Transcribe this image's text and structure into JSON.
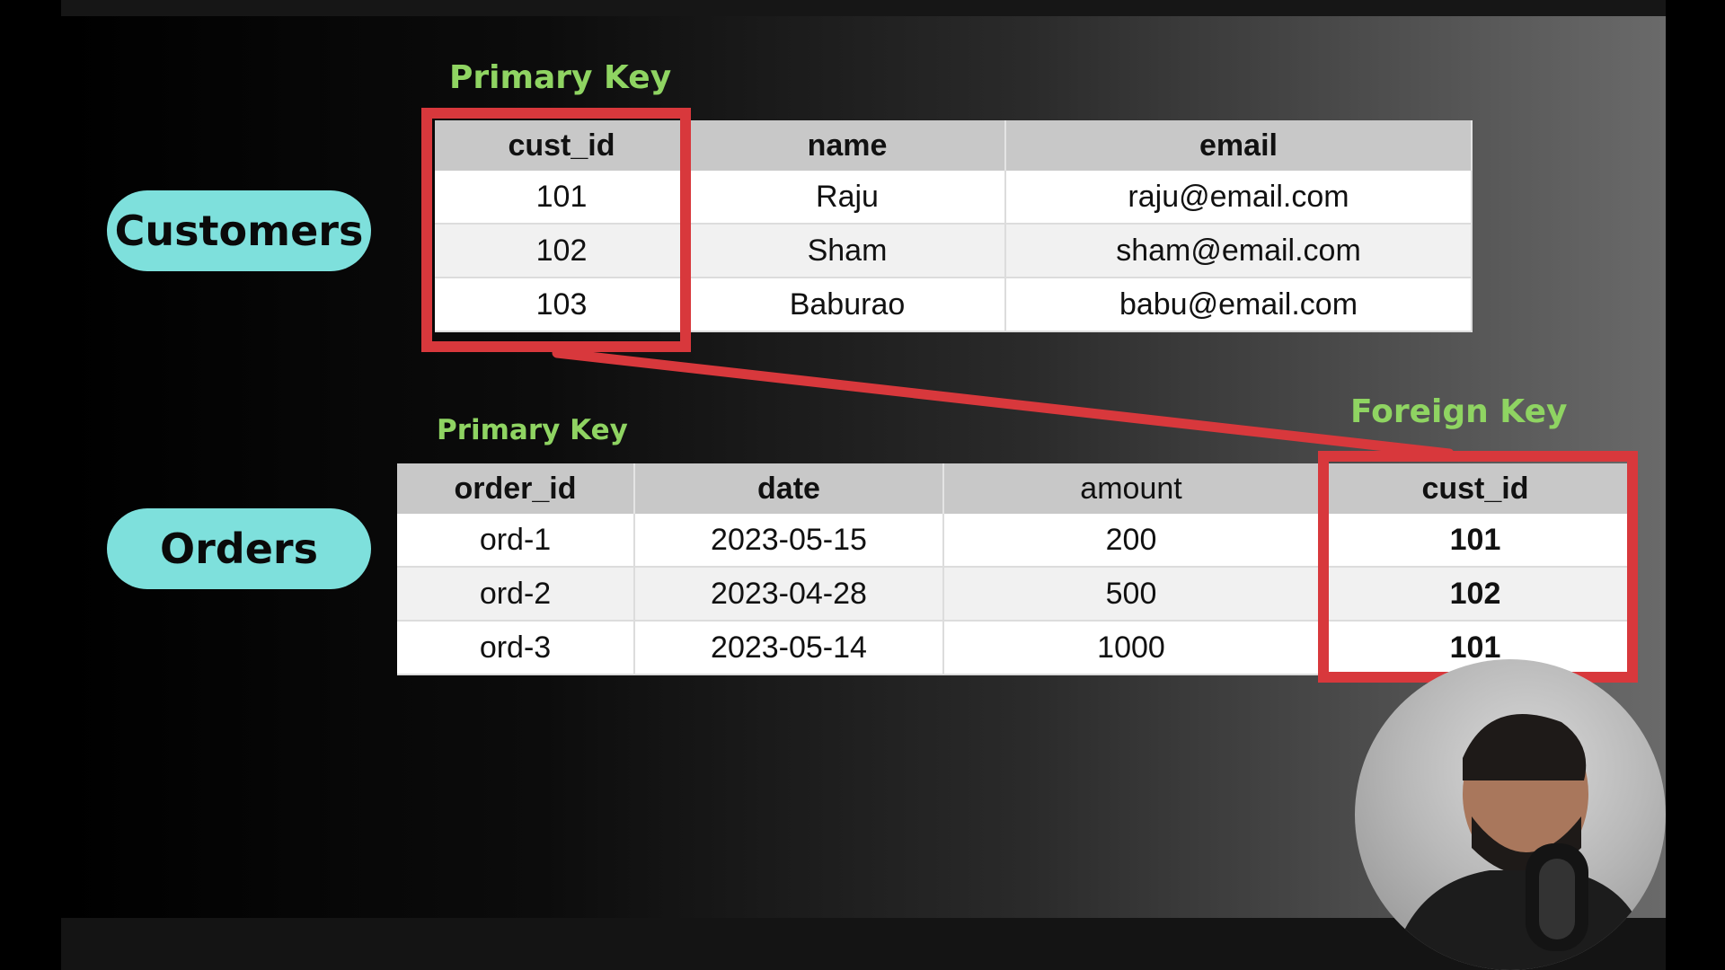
{
  "customers": {
    "pill_label": "Customers",
    "pk_label": "Primary Key",
    "columns": [
      "cust_id",
      "name",
      "email"
    ],
    "rows": [
      [
        "101",
        "Raju",
        "raju@email.com"
      ],
      [
        "102",
        "Sham",
        "sham@email.com"
      ],
      [
        "103",
        "Baburao",
        "babu@email.com"
      ]
    ]
  },
  "orders": {
    "pill_label": "Orders",
    "pk_label": "Primary Key",
    "fk_label": "Foreign Key",
    "columns": [
      "order_id",
      "date",
      "amount",
      "cust_id"
    ],
    "rows": [
      [
        "ord-1",
        "2023-05-15",
        "200",
        "101"
      ],
      [
        "ord-2",
        "2023-04-28",
        "500",
        "102"
      ],
      [
        "ord-3",
        "2023-05-14",
        "1000",
        "101"
      ]
    ]
  },
  "colors": {
    "pill": "#7ee0dc",
    "key_label": "#8fd462",
    "highlight": "#d8383c"
  }
}
